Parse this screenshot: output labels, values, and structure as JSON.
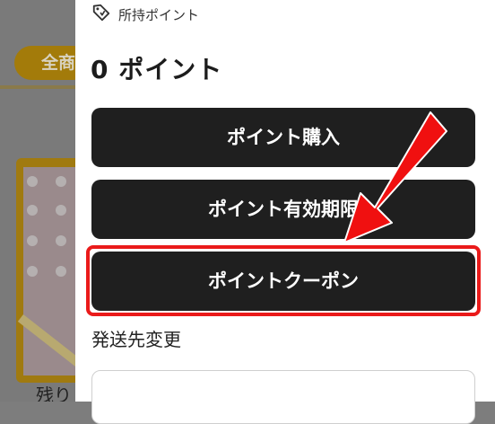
{
  "background": {
    "tab_label": "全商",
    "bottom_text": "残り"
  },
  "drawer": {
    "points_header": {
      "icon": "tag-icon",
      "label": "所持ポイント"
    },
    "points_value": "0 ポイント",
    "buttons": [
      {
        "label": "ポイント購入"
      },
      {
        "label": "ポイント有効期限"
      },
      {
        "label": "ポイントクーポン"
      }
    ],
    "highlighted_button_color": "#ea1a1a",
    "section_title": "発送先変更"
  },
  "annotation": {
    "arrow_color": "#f01010"
  }
}
